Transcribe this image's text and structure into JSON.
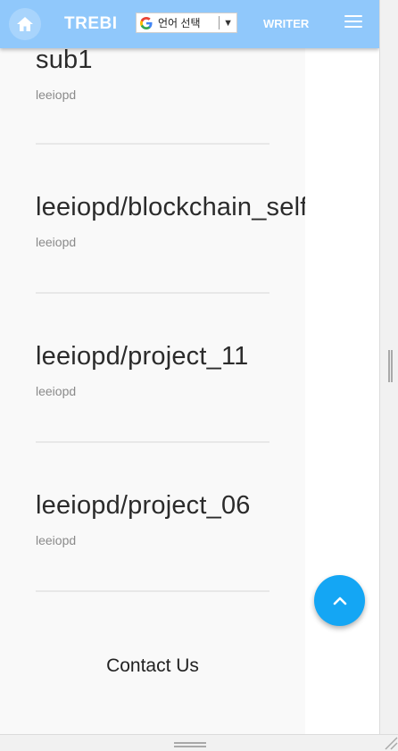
{
  "header": {
    "logo": "TREBI",
    "language_selector": "언어 선택",
    "writer_label": "WRITER",
    "home_icon": "home-icon",
    "menu_icon": "hamburger-menu-icon"
  },
  "posts": [
    {
      "title": "sub1",
      "author": "leeiopd"
    },
    {
      "title": "leeiopd/blockchain_selfstudy",
      "author": "leeiopd"
    },
    {
      "title": "leeiopd/project_11",
      "author": "leeiopd"
    },
    {
      "title": "leeiopd/project_06",
      "author": "leeiopd"
    }
  ],
  "footer": {
    "contact": "Contact Us"
  },
  "fab": {
    "icon": "chevron-up-icon"
  },
  "colors": {
    "header": "#90c8fb",
    "fab": "#14a6f4",
    "content_bg": "#f9f9f9"
  }
}
